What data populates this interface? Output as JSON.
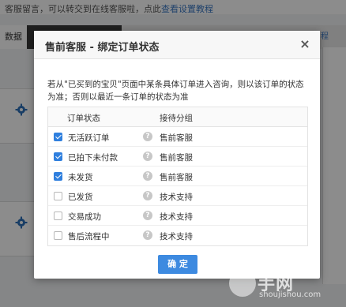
{
  "background": {
    "notice_text": "客服留言，可以转交到在线客服啦，点此",
    "notice_link": "查看设置教程",
    "tab_data": "数据",
    "right_link": "程",
    "gear_icon": "gear-icon"
  },
  "modal": {
    "title": "售前客服 - 绑定订单状态",
    "close_symbol": "×",
    "description": "若从\"已买到的宝贝\"页面中某条具体订单进入咨询，则以该订单的状态为准；否则以最近一条订单的状态为准",
    "columns": {
      "status": "订单状态",
      "group": "接待分组"
    },
    "rows": [
      {
        "status": "无活跃订单",
        "group": "售前客服",
        "checked": true
      },
      {
        "status": "已拍下未付款",
        "group": "售前客服",
        "checked": true
      },
      {
        "status": "未发货",
        "group": "售前客服",
        "checked": true
      },
      {
        "status": "已发货",
        "group": "技术支持",
        "checked": false
      },
      {
        "status": "交易成功",
        "group": "技术支持",
        "checked": false
      },
      {
        "status": "售后流程中",
        "group": "技术支持",
        "checked": false
      }
    ],
    "help_symbol": "?",
    "confirm_label": "确 定"
  },
  "watermark": {
    "text": "手网",
    "sub": "shoujishou.com"
  },
  "colors": {
    "accent": "#3d8ae0",
    "checkbox_checked": "#2f7fde",
    "overlay": "rgba(0,0,0,0.45)"
  }
}
